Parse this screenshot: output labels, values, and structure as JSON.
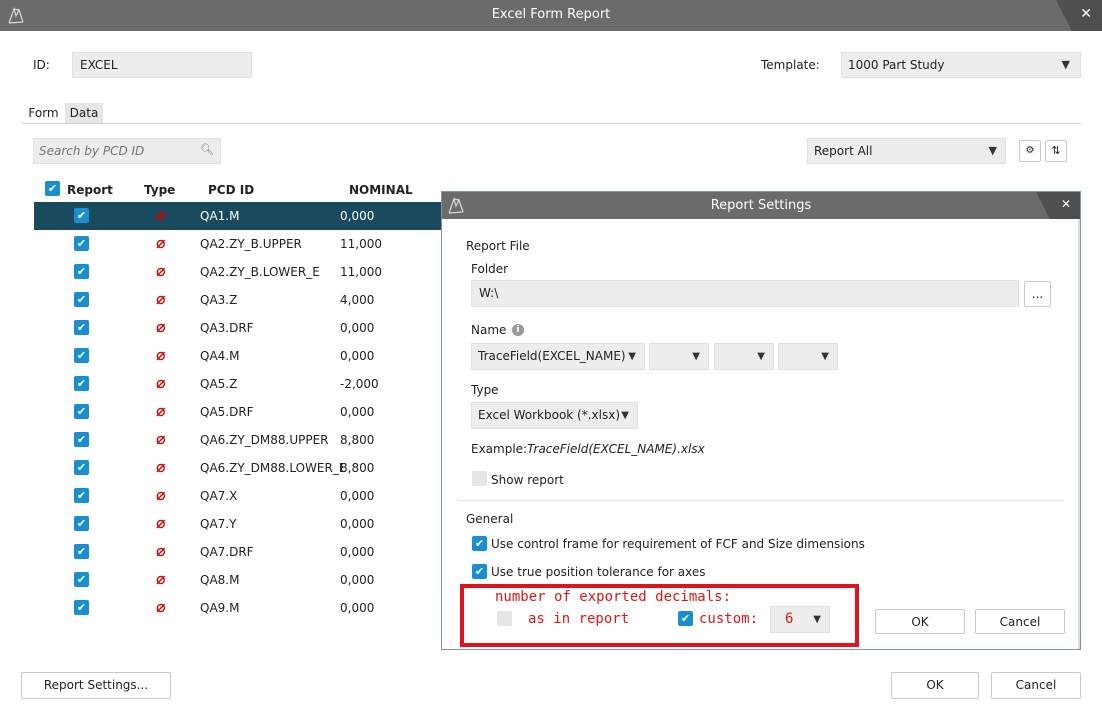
{
  "window": {
    "title": "Excel Form Report",
    "close": "✕"
  },
  "header": {
    "id_label": "ID:",
    "id_value": "EXCEL",
    "template_label": "Template:",
    "template_value": "1000 Part Study"
  },
  "tabs": [
    {
      "label": "Form"
    },
    {
      "label": "Data"
    }
  ],
  "search": {
    "placeholder": "Search by PCD ID"
  },
  "report_filter": {
    "value": "Report All"
  },
  "table": {
    "headers": {
      "report": "Report",
      "type": "Type",
      "pcd_id": "PCD ID",
      "nominal": "NOMINAL"
    },
    "type_symbol": "⌀",
    "rows": [
      {
        "id": "QA1.M",
        "nominal": "0,000"
      },
      {
        "id": "QA2.ZY_B.UPPER",
        "nominal": "11,000"
      },
      {
        "id": "QA2.ZY_B.LOWER_E",
        "nominal": "11,000"
      },
      {
        "id": "QA3.Z",
        "nominal": "4,000"
      },
      {
        "id": "QA3.DRF",
        "nominal": "0,000"
      },
      {
        "id": "QA4.M",
        "nominal": "0,000"
      },
      {
        "id": "QA5.Z",
        "nominal": "-2,000"
      },
      {
        "id": "QA5.DRF",
        "nominal": "0,000"
      },
      {
        "id": "QA6.ZY_DM88.UPPER",
        "nominal": "8,800"
      },
      {
        "id": "QA6.ZY_DM88.LOWER_E",
        "nominal": "8,800"
      },
      {
        "id": "QA7.X",
        "nominal": "0,000"
      },
      {
        "id": "QA7.Y",
        "nominal": "0,000"
      },
      {
        "id": "QA7.DRF",
        "nominal": "0,000"
      },
      {
        "id": "QA8.M",
        "nominal": "0,000"
      },
      {
        "id": "QA9.M",
        "nominal": "0,000"
      }
    ]
  },
  "footer": {
    "report_settings": "Report Settings...",
    "ok": "OK",
    "cancel": "Cancel"
  },
  "dialog": {
    "title": "Report Settings",
    "close": "✕",
    "report_file": "Report File",
    "folder_label": "Folder",
    "folder_value": "W:\\",
    "browse": "...",
    "name_label": "Name",
    "name_value": "TraceField(EXCEL_NAME)",
    "type_label": "Type",
    "type_value": "Excel Workbook (*.xlsx)",
    "example_label": "Example:",
    "example_value": "TraceField(EXCEL_NAME).xlsx",
    "show_report": "Show report",
    "general": "General",
    "opt_control_frame": "Use control frame for requirement of FCF and Size dimensions",
    "opt_true_position": "Use true position tolerance for axes",
    "decimals_title": "number of exported decimals:",
    "as_in_report": "as in report",
    "custom": "custom:",
    "custom_value": "6",
    "ok": "OK",
    "cancel": "Cancel"
  },
  "colors": {
    "accent": "#1a8fcf",
    "selected_row": "#194a5e",
    "annotation": "#e0141e",
    "titlebar": "#6b6b6b"
  }
}
